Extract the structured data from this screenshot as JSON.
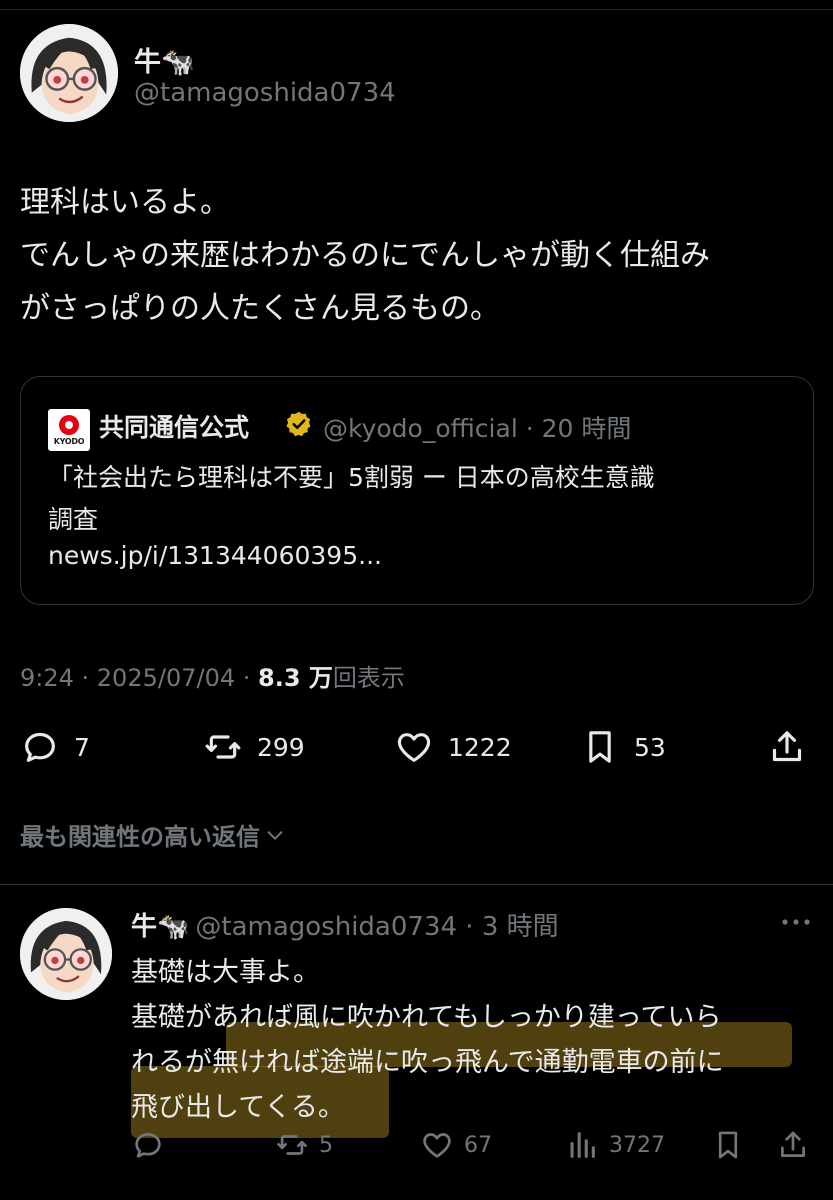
{
  "tweet": {
    "author_name": "牛🐄",
    "author_handle": "@tamagoshida0734",
    "text_lines": [
      "理科はいるよ。",
      "でんしゃの来歴はわかるのにでんしゃが動く仕組み",
      "がさっぱりの人たくさん見るもの。"
    ],
    "quote": {
      "logo_text": "KYODO",
      "name": "共同通信公式",
      "handle_time": "@kyodo_official · 20 時間",
      "text_lines": [
        "「社会出たら理科は不要」5割弱 ー 日本の高校生意識",
        "調査"
      ],
      "link": "news.jp/i/131344060395..."
    },
    "timestamp": "9:24 · 2025/07/04 · ",
    "views_count": "8.3 万",
    "views_label": "回表示",
    "actions": {
      "replies": "7",
      "retweets": "299",
      "likes": "1222",
      "bookmarks": "53"
    }
  },
  "relevant_replies_label": "最も関連性の高い返信",
  "reply": {
    "author_name": "牛🐄",
    "author_handle_time": "@tamagoshida0734 · 3 時間",
    "text_lines": [
      "基礎は大事よ。",
      "基礎があれば風に吹かれてもしっかり建っていら",
      "れるが無ければ途端に吹っ飛んで通勤電車の前に",
      "飛び出してくる。"
    ],
    "actions": {
      "replies": "",
      "retweets": "5",
      "likes": "67",
      "views": "3727"
    }
  },
  "colors": {
    "background": "#000000",
    "text": "#e7e9ea",
    "muted": "#71767b",
    "border": "#2f3336",
    "highlight": "#be9623",
    "kyodo_red": "#e60012",
    "verified_gold": "#e2b719"
  }
}
